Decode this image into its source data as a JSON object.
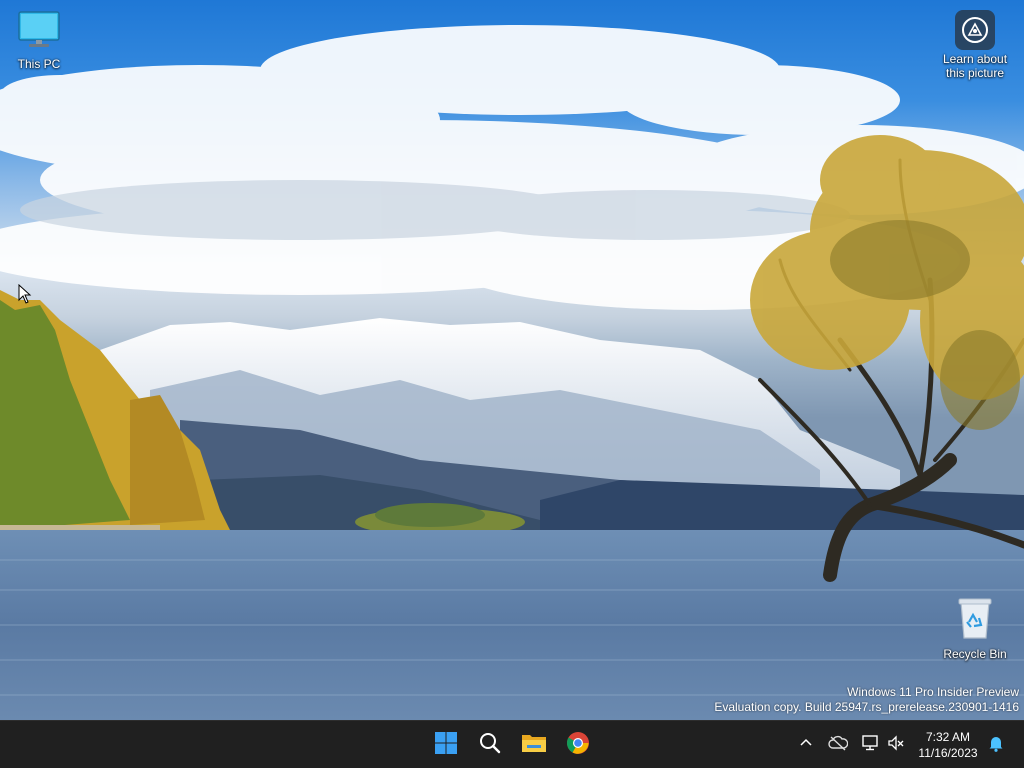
{
  "desktop": {
    "icons": [
      {
        "name": "this-pc",
        "label": "This PC",
        "icon": "monitor-icon"
      },
      {
        "name": "learn-about-picture",
        "label": "Learn about\nthis picture",
        "label_line1": "Learn about",
        "label_line2": "this picture",
        "icon": "camera-lens-icon"
      },
      {
        "name": "recycle-bin",
        "label": "Recycle Bin",
        "icon": "recycle-bin-icon"
      }
    ],
    "watermark": {
      "line1": "Windows 11 Pro Insider Preview",
      "line2": "Evaluation copy. Build 25947.rs_prerelease.230901-1416"
    }
  },
  "taskbar": {
    "apps": [
      {
        "name": "start",
        "icon": "windows-logo-icon",
        "color": "#3aa0f3"
      },
      {
        "name": "search",
        "icon": "search-icon",
        "color": "#ffffff"
      },
      {
        "name": "file-explorer",
        "icon": "folder-icon",
        "color": "#f2c43d"
      },
      {
        "name": "chrome",
        "icon": "chrome-icon",
        "color": "#4285f4"
      }
    ],
    "tray": {
      "icons": [
        "chevron-up-icon",
        "onedrive-offline-icon",
        "network-icon",
        "volume-muted-icon",
        "notification-bell-icon"
      ],
      "time": "7:32 AM",
      "date": "11/16/2023",
      "accent": "#4cc2ff"
    }
  }
}
